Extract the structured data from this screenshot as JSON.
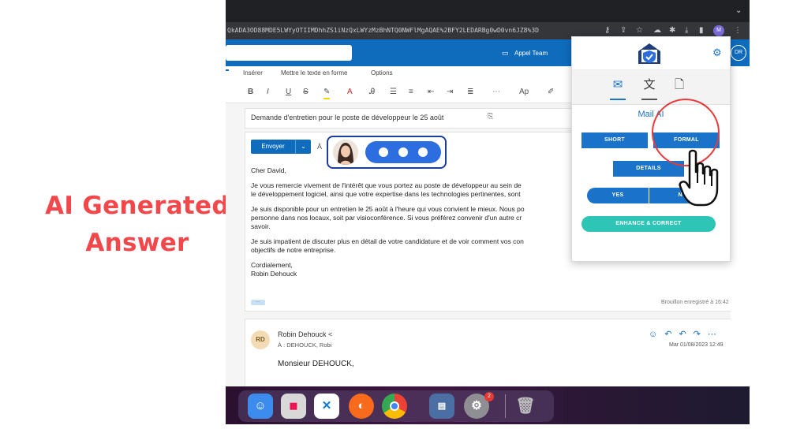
{
  "overlay": {
    "headline_line1": "AI Generated",
    "headline_line2": "Answer",
    "headline_color": "#f2474b"
  },
  "browser": {
    "url": "QkADA3OD88MDE5LWYyOTIIMDhhZS1iNzQxLWYzMzBhNTQ0NWFlMgAQAE%2BFY2LEDARBg0wD0vn6JZ8%3D",
    "profile_initial": "M"
  },
  "outlook": {
    "meeting_label": "Appel Team",
    "profile_initials": "DR",
    "tabs": [
      "Insérer",
      "Mettre le texte en forme",
      "Options"
    ],
    "subject": "Demande d'entretien pour le poste de développeur le 25 août",
    "send_label": "Envoyer",
    "to_label": "À",
    "body": {
      "greeting": "Cher David,",
      "p1_l1": "Je vous remercie vivement de l'intérêt que vous portez au poste de développeur au sein de",
      "p1_l2": "le développement logiciel, ainsi que votre expertise dans les technologies pertinentes, sont",
      "p2_l1": "Je suis disponible pour un entretien le 25 août à l'heure qui vous convient le mieux. Nous po",
      "p2_l2": "personne dans nos locaux, soit par visioconférence. Si vous préférez convenir d'un autre cr",
      "p2_l3": "savoir.",
      "p3_l1": "Je suis impatient de discuter plus en détail de votre candidature et de voir comment vos con",
      "p3_l2": "objectifs de notre entreprise.",
      "closing": "Cordialement,",
      "signature": "Robin Dehouck"
    },
    "draft_saved": "Brouillon enregistré à 16:42",
    "reply": {
      "avatar_initials": "RD",
      "sender": "Robin Dehouck <",
      "to": "À : DEHOUCK, Robi",
      "date": "Mar 01/08/2023 12:49",
      "greeting": "Monsieur DEHOUCK,"
    }
  },
  "mail_ai_panel": {
    "title": "Mail AI",
    "buttons": {
      "short": "SHORT",
      "formal": "FORMAL",
      "details": "DETAILS",
      "yes": "YES",
      "no": "NO",
      "enhance": "ENHANCE & CORRECT"
    },
    "tab_icons": [
      "reply-mail-icon",
      "translate-icon",
      "document-icon"
    ],
    "accent_color": "#1a73c8",
    "teal_color": "#2ec4b6"
  },
  "dock": {
    "notification_count": "2"
  }
}
